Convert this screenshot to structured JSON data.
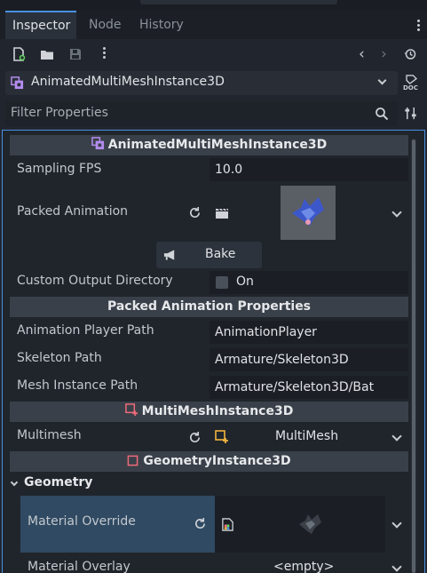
{
  "tabs": [
    {
      "label": "Inspector",
      "active": true
    },
    {
      "label": "Node",
      "active": false
    },
    {
      "label": "History",
      "active": false
    }
  ],
  "object_selector": {
    "name": "AnimatedMultiMeshInstance3D",
    "doc_label": "DOC"
  },
  "filter": {
    "placeholder": "Filter Properties"
  },
  "sections": {
    "animated": "AnimatedMultiMeshInstance3D",
    "packed_props": "Packed Animation Properties",
    "multimesh": "MultiMeshInstance3D",
    "geometry": "GeometryInstance3D"
  },
  "properties": {
    "sampling_fps": {
      "label": "Sampling FPS",
      "value": "10.0"
    },
    "packed_animation": {
      "label": "Packed Animation"
    },
    "bake": {
      "label": "Bake"
    },
    "custom_output": {
      "label": "Custom Output Directory",
      "value": "On"
    },
    "anim_player_path": {
      "label": "Animation Player Path",
      "value": "AnimationPlayer"
    },
    "skeleton_path": {
      "label": "Skeleton Path",
      "value": "Armature/Skeleton3D"
    },
    "mesh_instance_path": {
      "label": "Mesh Instance Path",
      "value": "Armature/Skeleton3D/Bat"
    },
    "multimesh": {
      "label": "Multimesh",
      "value": "MultiMesh"
    },
    "geometry_group": {
      "label": "Geometry"
    },
    "material_override": {
      "label": "Material Override"
    },
    "material_overlay": {
      "label": "Material Overlay",
      "value": "<empty>"
    }
  },
  "colors": {
    "accent": "#4a90e2",
    "section_bg": "#3a4049",
    "value_bg": "#1b1f25",
    "highlight_row": "#2f4a62",
    "node_icon_purple": "#b48cf0",
    "node_icon_red": "#f06a7a",
    "multimesh_icon_yellow": "#f0b43c"
  }
}
